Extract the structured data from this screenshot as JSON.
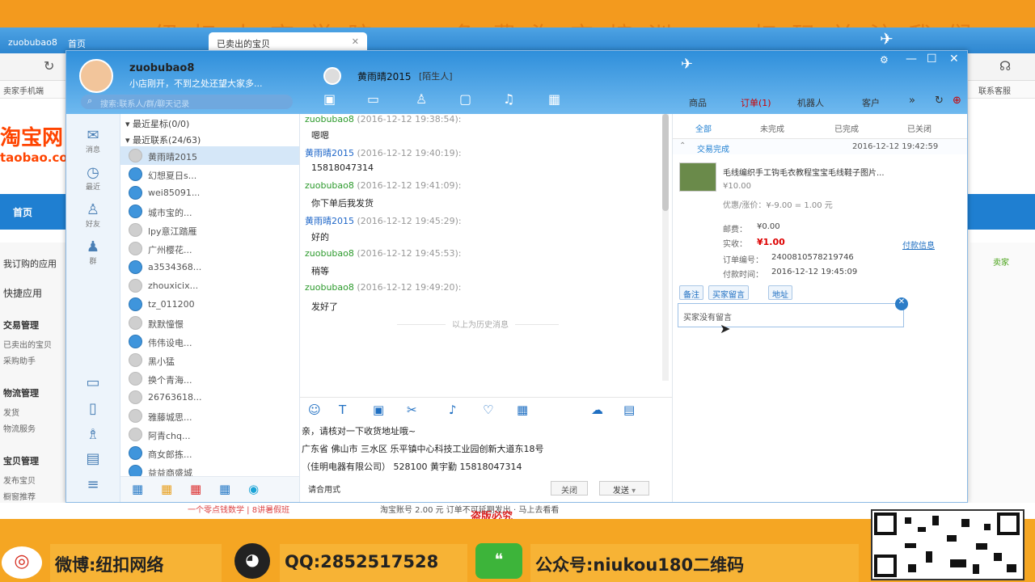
{
  "banner": {
    "top_text": "纽扣电商学院 · 免费淘宝培训 · 扫码关注我们",
    "weibo": "微博:纽扣网络",
    "qq": "QQ:2852517528",
    "wechat": "公众号:niukou180二维码",
    "under_a": "一个零点钱数学 | 8讲暑假班",
    "under_b": "淘宝账号 2.00 元 订单不可延期发出 · 马上去看看",
    "under_c": "盗版必究"
  },
  "browser": {
    "tab1": "zuobubao8",
    "tab2": "首页",
    "tab3": "已卖出的宝贝",
    "bar_left": "卖家手机端",
    "bar_right": "联系客服"
  },
  "taobao": {
    "logo": "淘宝网",
    "logo_sub": "taobao.com",
    "nav_home": "首页",
    "side": [
      "我订购的应用",
      "快捷应用",
      "交易管理",
      "已卖出的宝贝",
      "采购助手",
      "物流管理",
      "发货",
      "物流服务",
      "宝贝管理",
      "发布宝贝",
      "橱窗推荐"
    ],
    "right_label": "卖家"
  },
  "qn": {
    "user": "zuobubao8",
    "status": "小店刚开，不到之处还望大家多...",
    "search_placeholder": "搜索:联系人/群/聊天记录",
    "chat_partner": "黄雨晴2015",
    "chat_partner_tag": "[陌生人]",
    "left_nav": [
      "消息",
      "最近",
      "好友",
      "群"
    ],
    "groups": [
      "最近星标(0/0)",
      "最近联系(24/63)"
    ],
    "contacts": [
      "黄雨晴2015",
      "幻想夏日s...",
      "wei85091...",
      "城市宝的...",
      "lpy意江踏雁",
      "广州樱花...",
      "a3534368...",
      "zhouxicix...",
      "tz_011200",
      "默默憧憬",
      "伟伟设电...",
      "黑小猛",
      "换个青海...",
      "26763618...",
      "雅藤城思...",
      "阿青chq...",
      "商女郎拣...",
      "益益商盛城"
    ],
    "messages": [
      {
        "name": "zuobubao8",
        "time": "(2016-12-12 19:38:54):",
        "text": "嗯嗯"
      },
      {
        "name": "黄雨晴2015",
        "time": "(2016-12-12 19:40:19):",
        "text": "15818047314"
      },
      {
        "name": "zuobubao8",
        "time": "(2016-12-12 19:41:09):",
        "text": "你下单后我发货"
      },
      {
        "name": "黄雨晴2015",
        "time": "(2016-12-12 19:45:29):",
        "text": "好的"
      },
      {
        "name": "zuobubao8",
        "time": "(2016-12-12 19:45:53):",
        "text": "稍等"
      },
      {
        "name": "zuobubao8",
        "time": "(2016-12-12 19:49:20):",
        "text": "发好了"
      }
    ],
    "history_divider": "以上为历史消息",
    "input_lines": [
      "亲，请核对一下收货地址哦~",
      "广东省  佛山市  三水区  乐平镇中心科技工业园创新大道东18号",
      "（佳明电器有限公司）  528100  黄宇勤  15818047314"
    ],
    "reply_hint": "请合用式",
    "close_btn": "关闭",
    "send_btn": "发送",
    "top_tabs": [
      "商品",
      "订单(1)",
      "机器人",
      "客户"
    ]
  },
  "order": {
    "tabs": [
      "全部",
      "未完成",
      "已完成",
      "已关闭"
    ],
    "status": "交易完成",
    "date": "2016-12-12 19:42:59",
    "item_title": "毛线编织手工钩毛衣教程宝宝毛线鞋子图片...",
    "item_price": "¥10.00",
    "discount_label": "优惠/涨价：",
    "discount_val": "¥-9.00 = 1.00 元",
    "postage_label": "邮费：",
    "postage_val": "¥0.00",
    "paid_label": "实收：",
    "paid_val": "¥1.00",
    "pay_detail": "付款信息",
    "order_no_label": "订单编号：",
    "order_no_val": "2400810578219746",
    "pay_time_label": "付款时间：",
    "pay_time_val": "2016-12-12 19:45:09",
    "btn_note": "备注",
    "btn_buyer_msg": "买家留言",
    "btn_address": "地址",
    "note_text": "买家没有留言"
  }
}
